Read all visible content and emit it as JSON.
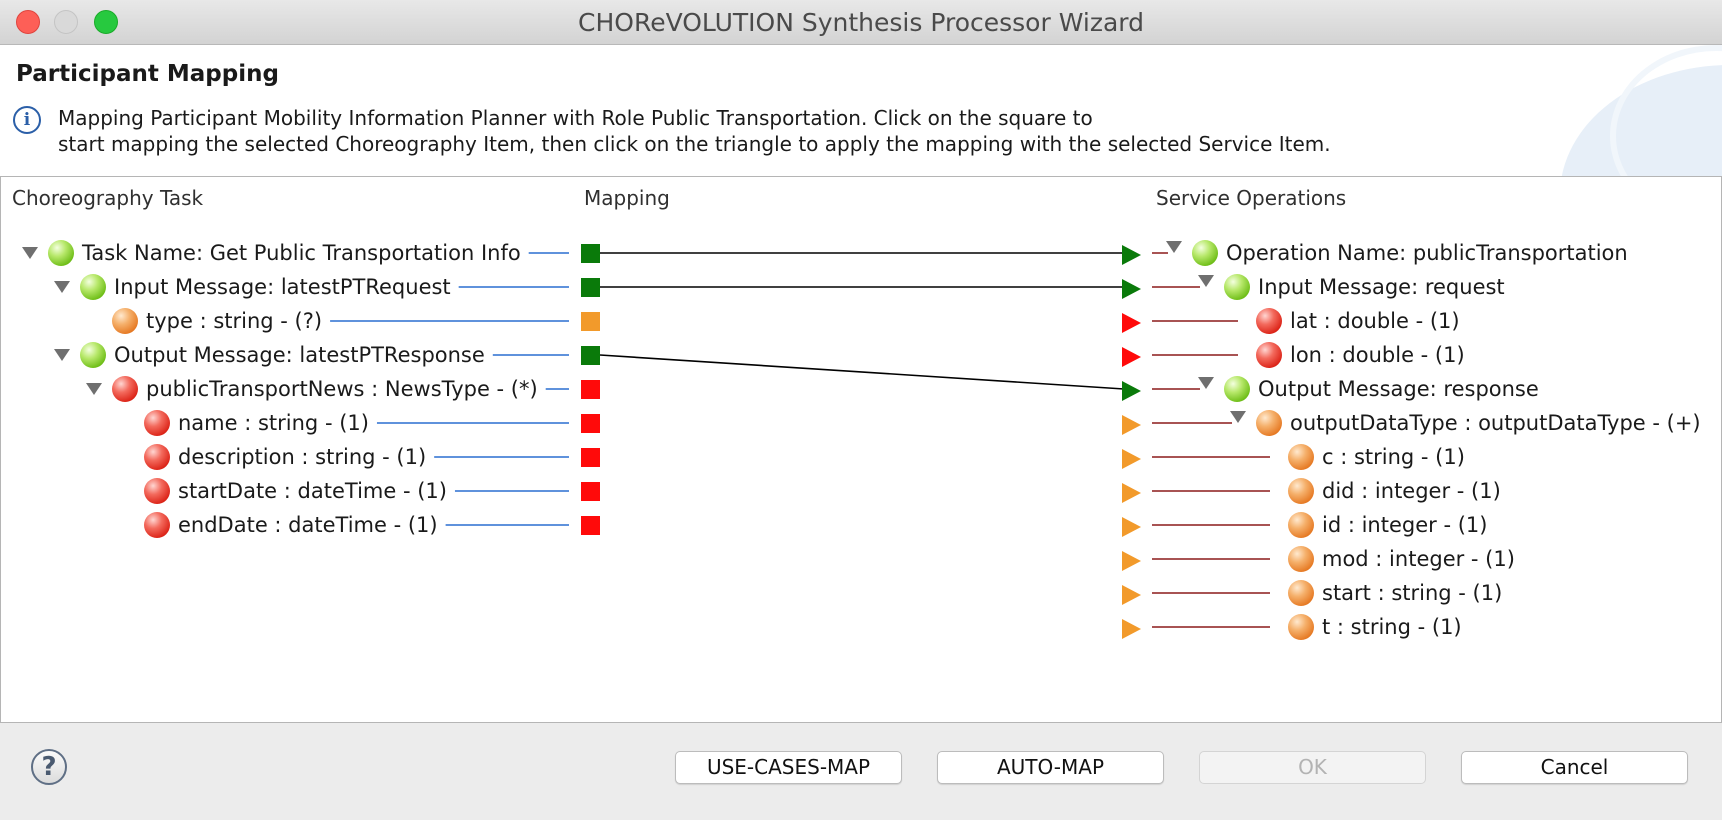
{
  "window": {
    "title": "CHOReVOLUTION Synthesis Processor Wizard"
  },
  "header": {
    "title": "Participant Mapping",
    "description_line1": "Mapping Participant Mobility Information Planner with Role Public Transportation. Click on the square to",
    "description_line2": "start mapping the selected Choreography Item, then click on the triangle to apply the mapping with the selected Service Item."
  },
  "columns": {
    "left": "Choreography Task",
    "middle": "Mapping",
    "right": "Service Operations"
  },
  "colors": {
    "green": "#0a7a0a",
    "orange": "#f29a2b",
    "red": "#ff0a0a",
    "blue_line": "#2a6fd1",
    "dark_red_line": "#8b1a1a"
  },
  "left_tree": [
    {
      "label": "Task Name: Get Public Transportation Info",
      "status": "green",
      "expanded": true,
      "map": "green"
    },
    {
      "label": "Input Message: latestPTRequest",
      "status": "green",
      "expanded": true,
      "map": "green"
    },
    {
      "label": "type : string - (?)",
      "status": "orange",
      "map": "orange"
    },
    {
      "label": "Output Message: latestPTResponse",
      "status": "green",
      "expanded": true,
      "map": "green"
    },
    {
      "label": "publicTransportNews : NewsType - (*)",
      "status": "red",
      "expanded": true,
      "map": "red"
    },
    {
      "label": "name : string - (1)",
      "status": "red",
      "map": "red"
    },
    {
      "label": "description : string - (1)",
      "status": "red",
      "map": "red"
    },
    {
      "label": "startDate : dateTime - (1)",
      "status": "red",
      "map": "red"
    },
    {
      "label": "endDate : dateTime - (1)",
      "status": "red",
      "map": "red"
    }
  ],
  "right_tree": [
    {
      "label": "Operation Name: publicTransportation",
      "status": "green",
      "expanded": true,
      "arrow": "green"
    },
    {
      "label": "Input Message: request",
      "status": "green",
      "expanded": true,
      "arrow": "green"
    },
    {
      "label": "lat : double - (1)",
      "status": "red",
      "arrow": "red"
    },
    {
      "label": "lon : double - (1)",
      "status": "red",
      "arrow": "red"
    },
    {
      "label": "Output Message: response",
      "status": "green",
      "expanded": true,
      "arrow": "green"
    },
    {
      "label": "outputDataType : outputDataType - (+)",
      "status": "orange",
      "expanded": true,
      "arrow": "orange"
    },
    {
      "label": "c : string - (1)",
      "status": "orange",
      "arrow": "orange"
    },
    {
      "label": "did : integer - (1)",
      "status": "orange",
      "arrow": "orange"
    },
    {
      "label": "id : integer - (1)",
      "status": "orange",
      "arrow": "orange"
    },
    {
      "label": "mod : integer - (1)",
      "status": "orange",
      "arrow": "orange"
    },
    {
      "label": "start : string - (1)",
      "status": "orange",
      "arrow": "orange"
    },
    {
      "label": "t : string - (1)",
      "status": "orange",
      "arrow": "orange"
    }
  ],
  "mappings": [
    {
      "from": "Task Name: Get Public Transportation Info",
      "to": "Operation Name: publicTransportation"
    },
    {
      "from": "Input Message: latestPTRequest",
      "to": "Input Message: request"
    },
    {
      "from": "Output Message: latestPTResponse",
      "to": "Output Message: response"
    }
  ],
  "footer": {
    "help_icon": "question-mark-icon",
    "use_cases_map": "USE-CASES-MAP",
    "auto_map": "AUTO-MAP",
    "ok": "OK",
    "cancel": "Cancel"
  }
}
